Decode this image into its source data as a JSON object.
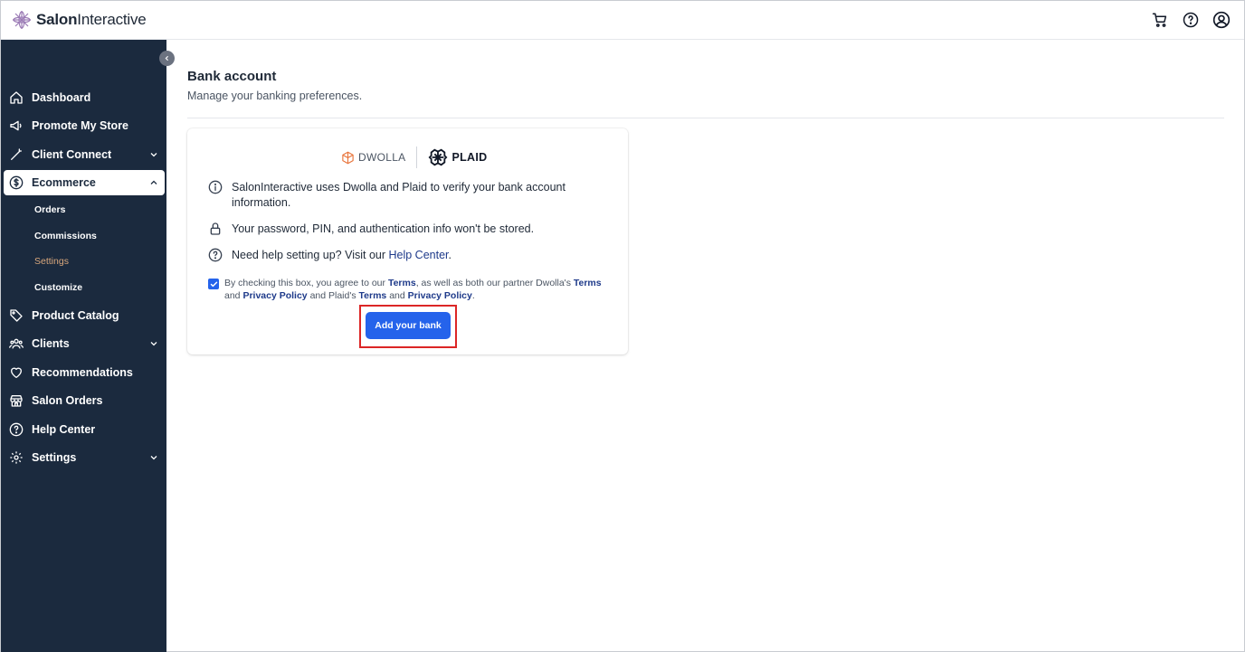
{
  "brand": {
    "name_bold": "Salon",
    "name_rest": "Interactive"
  },
  "topbar": {
    "icons": [
      "cart-icon",
      "help-icon",
      "account-icon"
    ]
  },
  "sidebar": {
    "items": [
      {
        "label": "Dashboard",
        "icon": "home-icon"
      },
      {
        "label": "Promote My Store",
        "icon": "megaphone-icon"
      },
      {
        "label": "Client Connect",
        "icon": "wand-icon"
      },
      {
        "label": "Ecommerce",
        "icon": "dollar-circle-icon"
      },
      {
        "label": "Product Catalog",
        "icon": "tag-icon"
      },
      {
        "label": "Clients",
        "icon": "users-icon"
      },
      {
        "label": "Recommendations",
        "icon": "heart-icon"
      },
      {
        "label": "Salon Orders",
        "icon": "store-icon"
      },
      {
        "label": "Help Center",
        "icon": "help-icon"
      },
      {
        "label": "Settings",
        "icon": "gear-icon"
      }
    ],
    "ecommerce_sub": [
      "Orders",
      "Commissions",
      "Settings",
      "Customize"
    ],
    "active_item": "Ecommerce",
    "current_sub": "Settings"
  },
  "page": {
    "title": "Bank account",
    "subtitle": "Manage your banking preferences."
  },
  "card": {
    "partners": {
      "dwolla": "DWOLLA",
      "plaid": "PLAID"
    },
    "info": {
      "verify": "SalonInteractive uses Dwolla and Plaid to verify your bank account information.",
      "storage": "Your password, PIN, and authentication info won't be stored.",
      "help_prefix": "Need help setting up? Visit our ",
      "help_link": "Help Center",
      "help_suffix": "."
    },
    "consent": {
      "checked": true,
      "part1": "By checking this box, you agree to our ",
      "terms1": "Terms",
      "part2": ", as well as both our partner Dwolla's ",
      "terms2": "Terms",
      "part3": " and ",
      "privacy1": "Privacy Policy",
      "part4": " and Plaid's ",
      "terms3": "Terms",
      "part5": " and ",
      "privacy2": "Privacy Policy",
      "part6": "."
    },
    "add_bank_label": "Add your bank"
  },
  "colors": {
    "sidebar_bg": "#1b2a3e",
    "accent_blue": "#2563eb",
    "link_blue": "#1e3a8a",
    "current_sub": "#d9a77c",
    "highlight_red": "#dc2626"
  }
}
